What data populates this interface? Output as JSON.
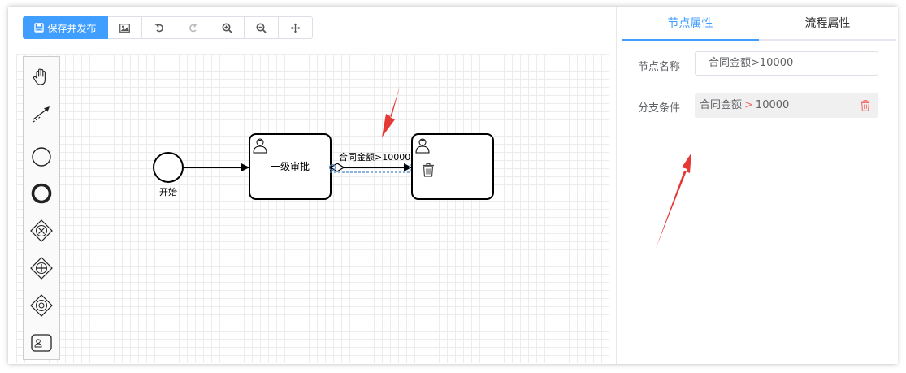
{
  "toolbar": {
    "save_label": "保存并发布",
    "icons": [
      "image-icon",
      "undo-icon",
      "redo-icon",
      "zoom-in-icon",
      "zoom-out-icon",
      "move-icon"
    ]
  },
  "palette": {
    "tools": [
      "hand-tool-icon",
      "connect-tool-icon",
      "start-event-icon",
      "end-event-icon",
      "exclusive-gateway-icon",
      "parallel-gateway-icon",
      "inclusive-gateway-icon",
      "user-task-icon"
    ]
  },
  "diagram": {
    "start_label": "开始",
    "task1_label": "一级审批",
    "flow_label": "合同金额>10000",
    "colors": {
      "selection": "#4a86c5",
      "stroke": "#000000"
    }
  },
  "panel": {
    "tabs": [
      {
        "label": "节点属性",
        "active": true
      },
      {
        "label": "流程属性",
        "active": false
      }
    ],
    "node_name_label": "节点名称",
    "node_name_value": "合同金额>10000",
    "condition_label": "分支条件",
    "condition": {
      "field": "合同金额",
      "operator": ">",
      "value": "10000"
    }
  },
  "colors": {
    "accent": "#409eff",
    "annotation_arrow": "#e53935",
    "delete": "#f56c6c"
  }
}
